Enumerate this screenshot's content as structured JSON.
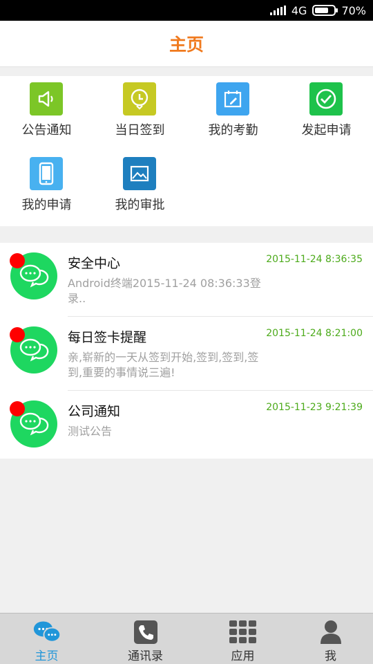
{
  "status_bar": {
    "network": "4G",
    "battery": "70%",
    "battery_level": 0.7
  },
  "header": {
    "title": "主页"
  },
  "quick_actions": [
    {
      "label": "公告通知",
      "icon": "speaker-icon",
      "color": "#7cc627"
    },
    {
      "label": "当日签到",
      "icon": "clock-pin-icon",
      "color": "#c6c923"
    },
    {
      "label": "我的考勤",
      "icon": "calendar-edit-icon",
      "color": "#3ea5ef"
    },
    {
      "label": "发起申请",
      "icon": "check-circle-icon",
      "color": "#1ec24b"
    },
    {
      "label": "我的申请",
      "icon": "phone-icon",
      "color": "#48b1f0"
    },
    {
      "label": "我的审批",
      "icon": "image-icon",
      "color": "#1e7fbf"
    }
  ],
  "messages": [
    {
      "name": "安全中心",
      "time": "2015-11-24 8:36:35",
      "preview": "Android终端2015-11-24 08:36:33登录.."
    },
    {
      "name": "每日签卡提醒",
      "time": "2015-11-24 8:21:00",
      "preview": "亲,崭新的一天从签到开始,签到,签到,签到,重要的事情说三遍!"
    },
    {
      "name": "公司通知",
      "time": "2015-11-23 9:21:39",
      "preview": "测试公告"
    }
  ],
  "tabs": [
    {
      "label": "主页",
      "icon": "chat-bubbles-icon",
      "active": true
    },
    {
      "label": "通讯录",
      "icon": "phone-handset-icon",
      "active": false
    },
    {
      "label": "应用",
      "icon": "grid-apps-icon",
      "active": false
    },
    {
      "label": "我",
      "icon": "person-icon",
      "active": false
    }
  ],
  "colors": {
    "accent": "#f07a1e",
    "active_tab": "#2196d9",
    "time_green": "#4caa1a",
    "avatar_green": "#1ed760",
    "unread_dot": "#ff0000"
  }
}
